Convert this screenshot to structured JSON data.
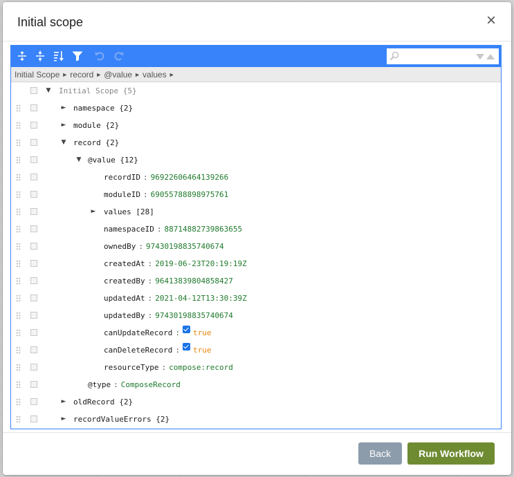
{
  "modal": {
    "title": "Initial scope",
    "close_glyph": "×"
  },
  "toolbar": {
    "icons": [
      "expand-all-icon",
      "collapse-all-icon",
      "sort-icon",
      "filter-icon",
      "undo-icon",
      "redo-icon"
    ],
    "search_placeholder": "",
    "accent_color": "#3883fa"
  },
  "breadcrumb": {
    "items": [
      "Initial Scope",
      "record",
      "@value",
      "values"
    ],
    "separator": "►"
  },
  "tree": {
    "root": {
      "label": "Initial Scope",
      "count": "{5}"
    },
    "namespace": {
      "key": "namespace",
      "count": "{2}"
    },
    "module": {
      "key": "module",
      "count": "{2}"
    },
    "record": {
      "key": "record",
      "count": "{2}"
    },
    "value": {
      "key": "@value",
      "count": "{12}"
    },
    "recordID": {
      "key": "recordID",
      "value": "96922606464139266"
    },
    "moduleID": {
      "key": "moduleID",
      "value": "69055788898975761"
    },
    "values": {
      "key": "values",
      "count": "[28]"
    },
    "namespaceID": {
      "key": "namespaceID",
      "value": "88714882739863655"
    },
    "ownedBy": {
      "key": "ownedBy",
      "value": "97430198835740674"
    },
    "createdAt": {
      "key": "createdAt",
      "value": "2019-06-23T20:19:19Z"
    },
    "createdBy": {
      "key": "createdBy",
      "value": "96413839804858427"
    },
    "updatedAt": {
      "key": "updatedAt",
      "value": "2021-04-12T13:30:39Z"
    },
    "updatedBy": {
      "key": "updatedBy",
      "value": "97430198835740674"
    },
    "canUpdateRecord": {
      "key": "canUpdateRecord",
      "value": "true"
    },
    "canDeleteRecord": {
      "key": "canDeleteRecord",
      "value": "true"
    },
    "resourceType": {
      "key": "resourceType",
      "value": "compose:record"
    },
    "type": {
      "key": "@type",
      "value": "ComposeRecord"
    },
    "oldRecord": {
      "key": "oldRecord",
      "count": "{2}"
    },
    "recordValueErrors": {
      "key": "recordValueErrors",
      "count": "{2}"
    },
    "separator": ":",
    "glyph_expanded": "▼",
    "glyph_collapsed": "►"
  },
  "footer": {
    "back_label": "Back",
    "run_label": "Run Workflow",
    "back_color": "#8c9cab",
    "run_color": "#6f8b32"
  }
}
